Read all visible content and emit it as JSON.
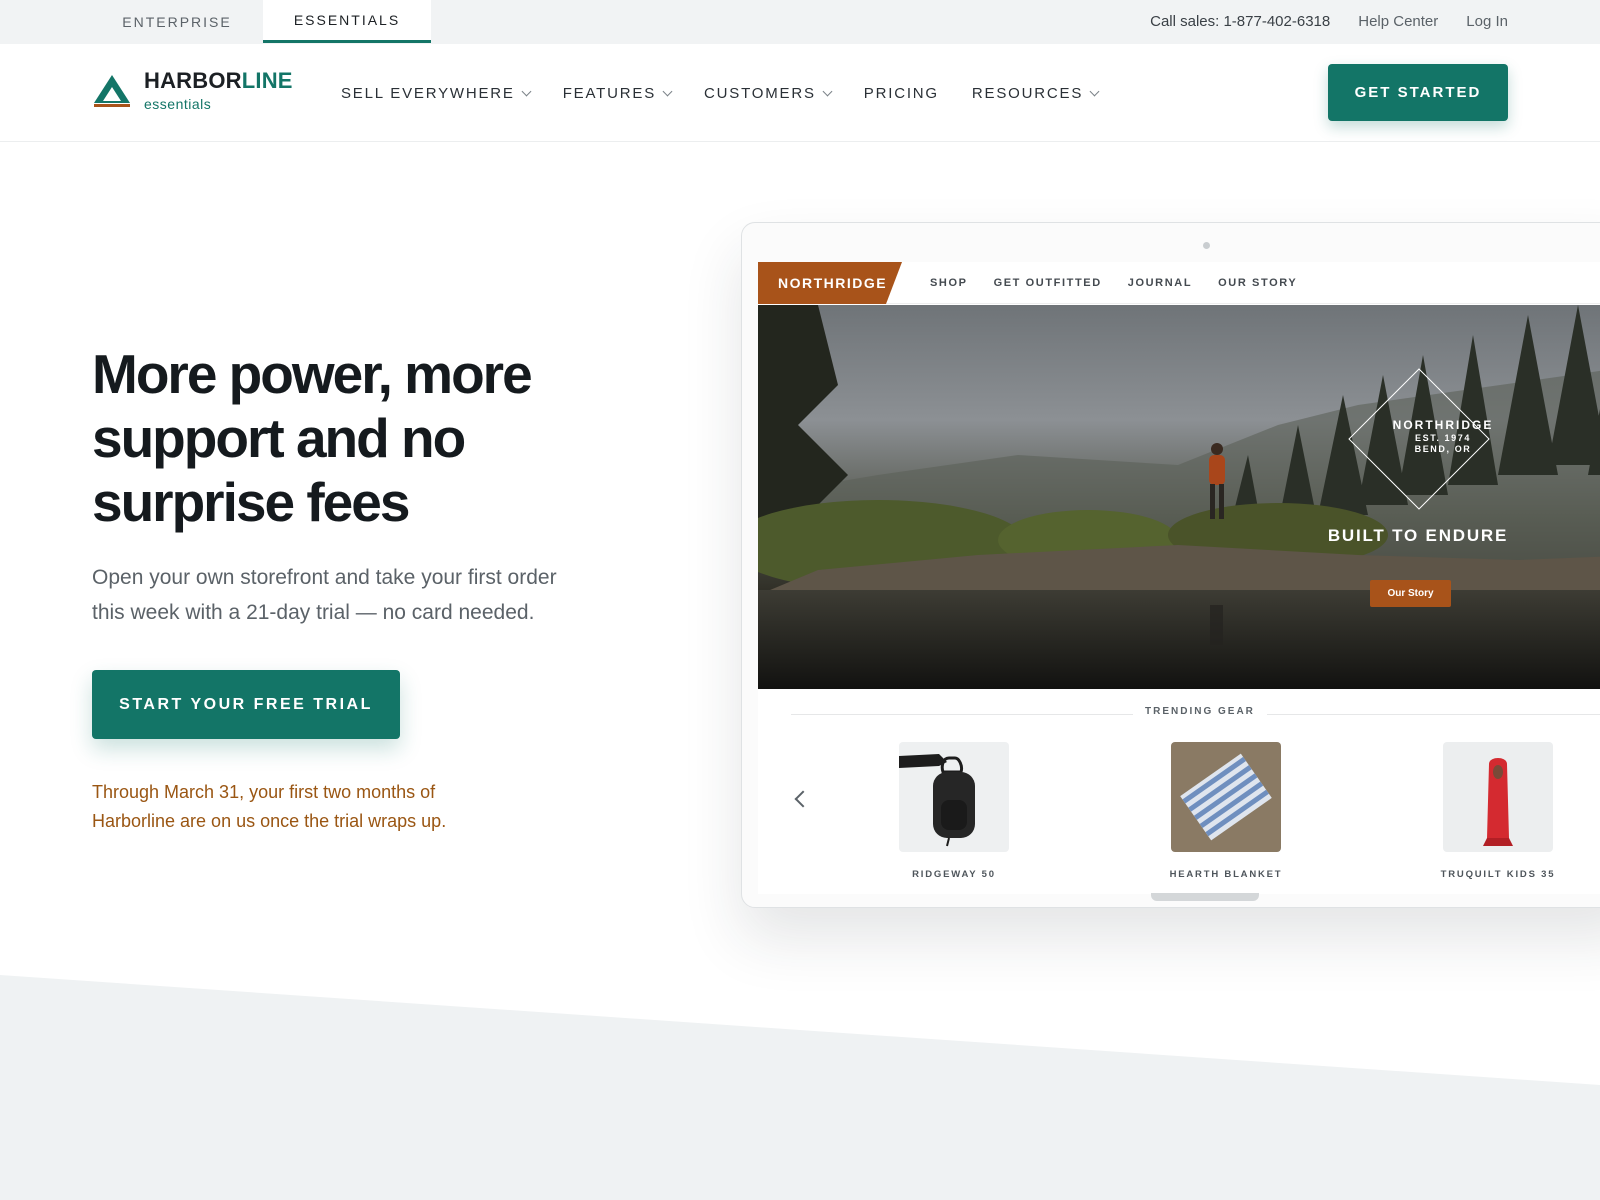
{
  "utility": {
    "tabs": [
      "ENTERPRISE",
      "ESSENTIALS"
    ],
    "active_tab": "ESSENTIALS",
    "sales": "Call sales: 1-877-402-6318",
    "help": "Help Center",
    "login": "Log In"
  },
  "nav": {
    "logo_primary": "HARBOR",
    "logo_accent": "LINE",
    "logo_sub": "essentials",
    "items": [
      {
        "label": "SELL EVERYWHERE",
        "dropdown": true
      },
      {
        "label": "FEATURES",
        "dropdown": true
      },
      {
        "label": "CUSTOMERS",
        "dropdown": true
      },
      {
        "label": "PRICING",
        "dropdown": false
      },
      {
        "label": "RESOURCES",
        "dropdown": true
      }
    ],
    "cta": "GET STARTED"
  },
  "hero": {
    "title": "More power, more support and no surprise fees",
    "subtitle": "Open your own storefront and take your first order this week with a 21-day trial — no card needed.",
    "cta": "START YOUR FREE TRIAL",
    "promo": "Through March 31, your first two months of Harborline are on us once the trial wraps up."
  },
  "store": {
    "brand": "NORTHRIDGE",
    "links": [
      "SHOP",
      "GET OUTFITTED",
      "JOURNAL",
      "OUR STORY"
    ],
    "badge_name": "NORTHRIDGE",
    "badge_est": "EST. 1974",
    "badge_loc": "BEND, OR",
    "tagline": "BUILT TO ENDURE",
    "story_button": "Our Story",
    "trending_title": "TRENDING GEAR",
    "products": [
      "RIDGEWAY 50",
      "HEARTH BLANKET",
      "TRUQUILT KIDS 35"
    ]
  },
  "colors": {
    "brand_green": "#137567",
    "promo_orange": "#9a5613",
    "store_rust": "#a8531a"
  }
}
